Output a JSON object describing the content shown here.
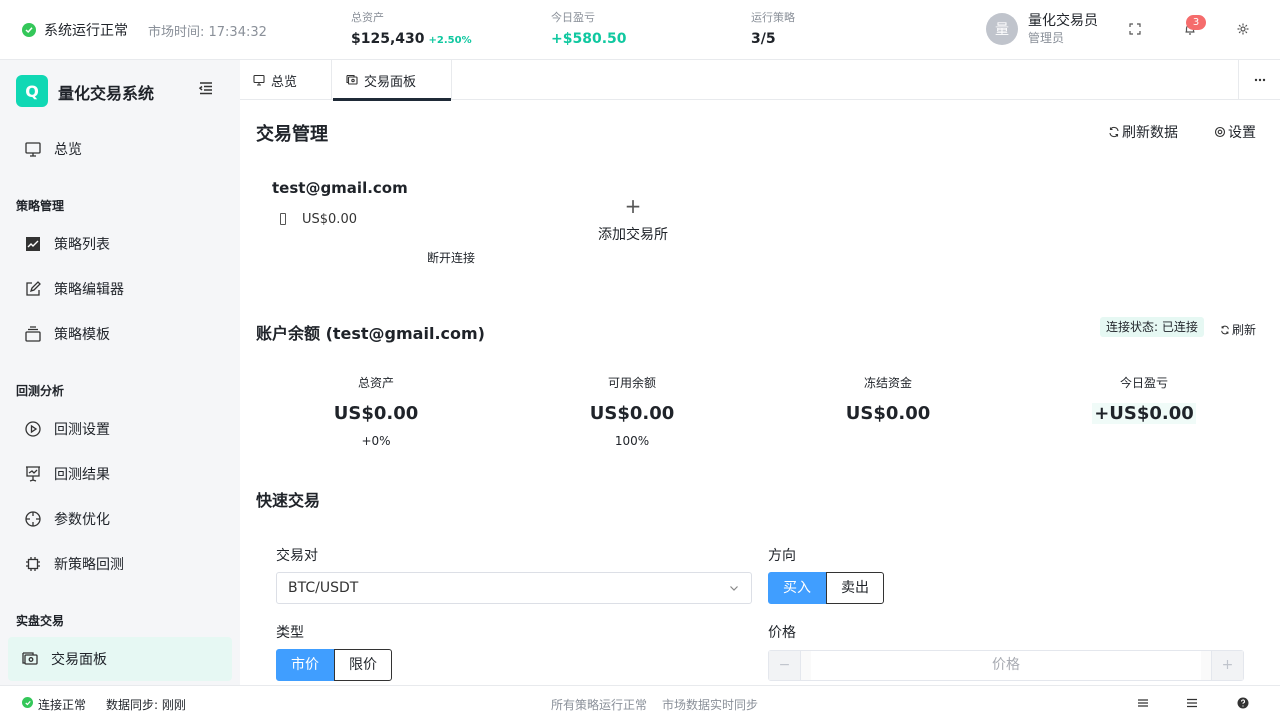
{
  "header": {
    "status_text": "系统运行正常",
    "market_time": "市场时间: 17:34:32",
    "stats": [
      {
        "label": "总资产",
        "value": "$125,430",
        "change": "+2.50%"
      },
      {
        "label": "今日盈亏",
        "value": "+$580.50"
      },
      {
        "label": "运行策略",
        "value": "3/5"
      }
    ],
    "user": {
      "avatar": "量",
      "name": "量化交易员",
      "role": "管理员"
    },
    "notifications": "3",
    "icons": [
      "fullscreen-icon",
      "bell-icon",
      "gear-icon"
    ]
  },
  "sidebar": {
    "logo": "Q",
    "title": "量化交易系统",
    "overview": "总览",
    "groups": {
      "strategy": "策略管理",
      "backtest": "回测分析",
      "live": "实盘交易"
    },
    "items": {
      "strategy_list": "策略列表",
      "strategy_editor": "策略编辑器",
      "strategy_templates": "策略模板",
      "backtest_settings": "回测设置",
      "backtest_results": "回测结果",
      "param_optimization": "参数优化",
      "new_backtest": "新策略回测",
      "trade_panel": "交易面板"
    }
  },
  "tabs": [
    "总览",
    "交易面板"
  ],
  "main": {
    "title": "交易管理",
    "refresh_data": "刷新数据",
    "settings": "设置",
    "account": {
      "email": "test@gmail.com",
      "balance": "US$0.00",
      "disconnect": "断开连接"
    },
    "add_exchange": "添加交易所",
    "balance_section": {
      "title": "账户余额 (test@gmail.com)",
      "connection": "连接状态: 已连接",
      "refresh": "刷新",
      "cards": [
        {
          "label": "总资产",
          "value": "US$0.00",
          "sub": "+0%"
        },
        {
          "label": "可用余额",
          "value": "US$0.00",
          "sub": "100%"
        },
        {
          "label": "冻结资金",
          "value": "US$0.00",
          "sub": ""
        },
        {
          "label": "今日盈亏",
          "value": "+US$0.00",
          "sub": ""
        }
      ]
    },
    "quick_trade": {
      "title": "快速交易",
      "pair_label": "交易对",
      "pair_value": "BTC/USDT",
      "side_label": "方向",
      "side_buy": "买入",
      "side_sell": "卖出",
      "type_label": "类型",
      "type_market": "市价",
      "type_limit": "限价",
      "price_label": "价格",
      "price_placeholder": "价格"
    }
  },
  "footer": {
    "connection": "连接正常",
    "sync": "数据同步: 刚刚",
    "strategies": "所有策略运行正常",
    "market": "市场数据实时同步"
  },
  "colors": {
    "accent": "#10d8b4",
    "primary": "#409eff",
    "ok": "#34c759",
    "badge": "#f56c6c"
  }
}
